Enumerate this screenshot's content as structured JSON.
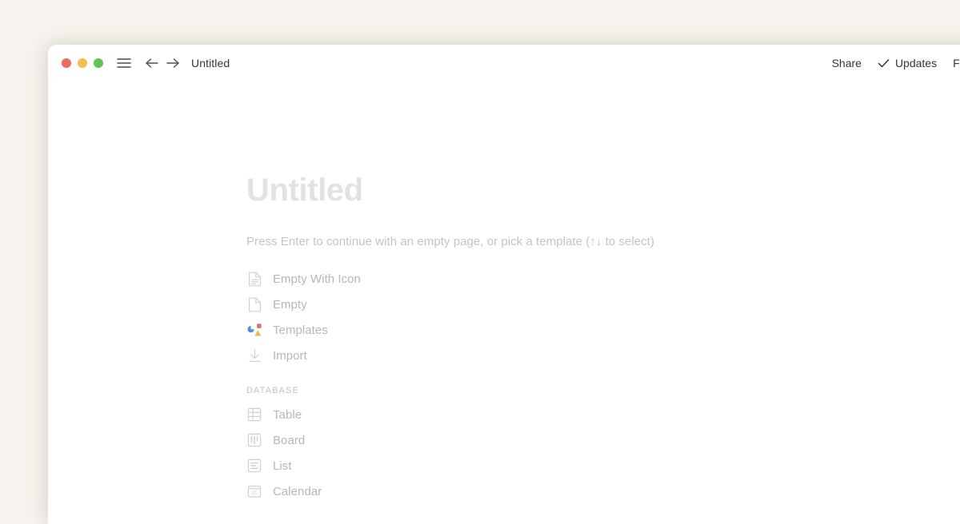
{
  "window": {
    "traffic_lights": [
      {
        "name": "close",
        "color": "#ee6a5f"
      },
      {
        "name": "minimize",
        "color": "#f5bd4f"
      },
      {
        "name": "maximize",
        "color": "#61c454"
      }
    ],
    "titlebar": {
      "menu_icon": "hamburger-icon",
      "back_icon": "arrow-left-icon",
      "forward_icon": "arrow-right-icon",
      "breadcrumb": "Untitled",
      "actions": [
        {
          "label": "Share",
          "icon": null
        },
        {
          "label": "Updates",
          "icon": "check-icon"
        },
        {
          "label": "Favori",
          "icon": null
        }
      ]
    }
  },
  "page": {
    "title": "Untitled",
    "hint": "Press Enter to continue with an empty page, or pick a template (↑↓ to select)",
    "options": [
      {
        "label": "Empty With Icon",
        "icon": "document-lines-icon"
      },
      {
        "label": "Empty",
        "icon": "document-blank-icon"
      },
      {
        "label": "Templates",
        "icon": "templates-shapes-icon"
      },
      {
        "label": "Import",
        "icon": "download-icon"
      }
    ],
    "database_section": {
      "heading": "Database",
      "options": [
        {
          "label": "Table",
          "icon": "table-icon"
        },
        {
          "label": "Board",
          "icon": "board-icon"
        },
        {
          "label": "List",
          "icon": "list-icon"
        },
        {
          "label": "Calendar",
          "icon": "calendar-icon",
          "icon_text": "31"
        }
      ]
    }
  },
  "colors": {
    "desktop_background": "#f7f4ef",
    "window_background": "#ffffff",
    "title_placeholder": "#e3e2e0",
    "muted_text": "#b9b7b3",
    "templates_blue": "#4a90d9",
    "templates_red": "#e06c60",
    "templates_yellow": "#f0b849"
  }
}
